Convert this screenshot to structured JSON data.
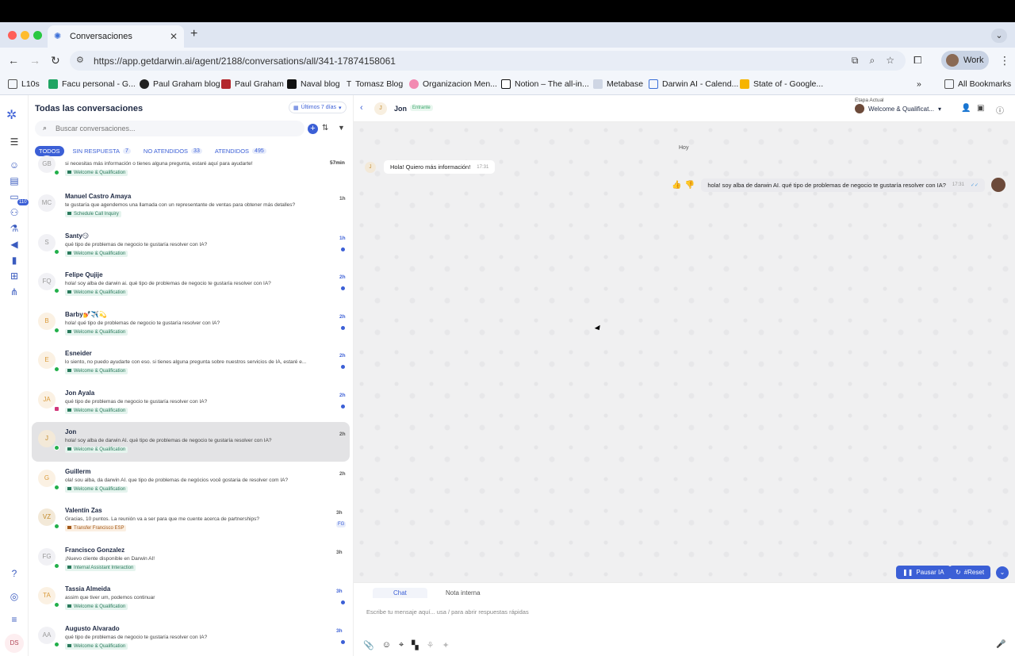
{
  "browser": {
    "tab_title": "Conversaciones",
    "url": "https://app.getdarwin.ai/agent/2188/conversations/all/341-17874158061",
    "profile_label": "Work",
    "bookmarks": [
      "L10s",
      "Facu personal - G...",
      "Paul Graham blog",
      "Paul Graham",
      "Naval blog",
      "Tomasz Blog",
      "Organizacion Men...",
      "Notion – The all-in...",
      "Metabase",
      "Darwin AI - Calend...",
      "State of - Google..."
    ],
    "all_bookmarks_label": "All Bookmarks"
  },
  "rail": {
    "badge": "110",
    "user_initials": "DS"
  },
  "list": {
    "title": "Todas las conversaciones",
    "range_label": "Últimos 7 días",
    "search_placeholder": "Buscar conversaciones...",
    "filters": [
      {
        "label": "TODOS",
        "count": ""
      },
      {
        "label": "SIN RESPUESTA",
        "count": "7"
      },
      {
        "label": "NO ATENDIDOS",
        "count": "33"
      },
      {
        "label": "ATENDIDOS",
        "count": "495"
      }
    ],
    "rows": [
      {
        "initials": "GB",
        "name": "",
        "msg": "si necesitas más información o tienes alguna pregunta, estaré aquí para ayudarte!",
        "tag": "Welcome & Qualification",
        "time": "57min"
      },
      {
        "initials": "MC",
        "name": "Manuel Castro Amaya",
        "msg": "te gustaría que agendemos una llamada con un representante de ventas para obtener más detalles?",
        "tag": "Schedule Call Inquiry",
        "time": "1h"
      },
      {
        "initials": "S",
        "name": "Santy😏",
        "msg": "qué tipo de problemas de negocio te gustaría resolver con IA?",
        "tag": "Welcome & Qualification",
        "time": "1h"
      },
      {
        "initials": "FQ",
        "name": "Felipe Qujije",
        "msg": "hola! soy alba de darwin ai. qué tipo de problemas de negocio te gustaría resolver con IA?",
        "tag": "Welcome & Qualification",
        "time": "2h"
      },
      {
        "initials": "B",
        "name": "Barby💅✈️💫",
        "msg": "hola! qué tipo de problemas de negocio te gustaría resolver con IA?",
        "tag": "Welcome & Qualification",
        "time": "2h"
      },
      {
        "initials": "E",
        "name": "Esneider",
        "msg": "lo siento, no puedo ayudarte con eso. si tienes alguna pregunta sobre nuestros servicios de IA, estaré e...",
        "tag": "Welcome & Qualification",
        "time": "2h"
      },
      {
        "initials": "JA",
        "name": "Jon Ayala",
        "msg": "qué tipo de problemas de negocio te gustaría resolver con IA?",
        "tag": "Welcome & Qualification",
        "time": "2h"
      },
      {
        "initials": "J",
        "name": "Jon",
        "msg": "hola! soy alba de darwin AI. qué tipo de problemas de negocio te gustaría resolver con IA?",
        "tag": "Welcome & Qualification",
        "time": "2h"
      },
      {
        "initials": "G",
        "name": "Guillerm",
        "msg": "ola! sou alba, da darwin AI. que tipo de problemas de negócios você gostaria de resolver com IA?",
        "tag": "Welcome & Qualification",
        "time": "2h"
      },
      {
        "initials": "VZ",
        "name": "Valentín Zas",
        "msg": "Gracias, 10 puntos. La reunión va a ser para que me cuente acerca de partnerships?",
        "tag": "Transfer Francisco ESP",
        "time": "3h",
        "chip": "FG"
      },
      {
        "initials": "FG",
        "name": "Francisco Gonzalez",
        "msg": "¡Nuevo cliente disponible en Darwin AI!",
        "tag": "Internal Assistant Interaction",
        "time": "3h"
      },
      {
        "initials": "TA",
        "name": "Tassia Almeida",
        "msg": "assim que tiver um, podemos continuar",
        "tag": "Welcome & Qualification",
        "time": "3h"
      },
      {
        "initials": "AA",
        "name": "Augusto Alvarado",
        "msg": "qué tipo de problemas de negocio te gustaría resolver con IA?",
        "tag": "Welcome & Qualification",
        "time": "3h"
      }
    ]
  },
  "chat": {
    "contact_initial": "J",
    "contact_name": "Jon",
    "status": "Entrante",
    "etapa_label": "Etapa Actual",
    "etapa_value": "Welcome & Qualificat...",
    "day_separator": "Hoy",
    "incoming": {
      "text": "Hola! Quiero más información!",
      "time": "17:31"
    },
    "outgoing": {
      "text": "hola! soy alba de darwin AI. qué tipo de problemas de negocio te gustaría resolver con IA?",
      "time": "17:31"
    },
    "tabs": [
      "Chat",
      "Nota interna"
    ],
    "pause_label": "Pausar IA",
    "reset_label": "#Reset",
    "input_placeholder": "Escribe tu mensaje aquí... usa / para abrir respuestas rápidas"
  }
}
